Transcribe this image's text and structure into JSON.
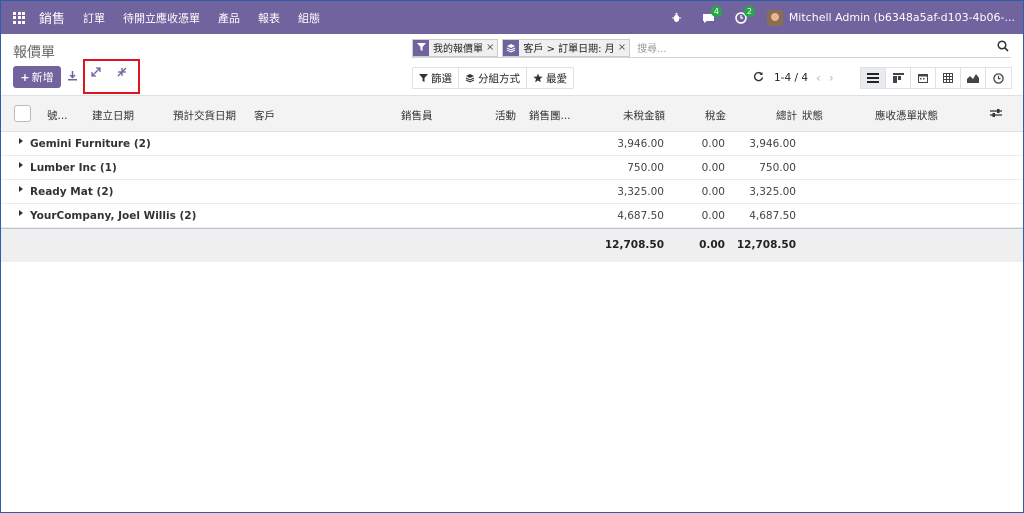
{
  "navbar": {
    "brand": "銷售",
    "menu": [
      "訂單",
      "待開立應收憑單",
      "產品",
      "報表",
      "組態"
    ],
    "messages_count": "4",
    "activities_count": "2",
    "user": "Mitchell Admin (b6348a5af-d103-4b06-..."
  },
  "control": {
    "title": "報價單",
    "new_label": "新增",
    "facets": [
      {
        "icon": "filter-icon",
        "text": "我的報價單"
      },
      {
        "icon": "layers-icon",
        "text": "客戶 > 訂單日期: 月"
      }
    ],
    "search_placeholder": "搜尋...",
    "filter_label": "篩選",
    "groupby_label": "分組方式",
    "favorite_label": "最愛",
    "pager": "1-4 / 4"
  },
  "table": {
    "headers": {
      "number": "號...",
      "create_date": "建立日期",
      "delivery_date": "預計交貨日期",
      "customer": "客戶",
      "salesperson": "銷售員",
      "activity": "活動",
      "sales_team": "銷售團...",
      "untaxed": "未稅金額",
      "tax": "稅金",
      "total": "總計",
      "status": "狀態",
      "invoice_status": "應收憑單狀態"
    },
    "groups": [
      {
        "name": "Gemini Furniture (2)",
        "untaxed": "3,946.00",
        "tax": "0.00",
        "total": "3,946.00"
      },
      {
        "name": "Lumber Inc (1)",
        "untaxed": "750.00",
        "tax": "0.00",
        "total": "750.00"
      },
      {
        "name": "Ready Mat (2)",
        "untaxed": "3,325.00",
        "tax": "0.00",
        "total": "3,325.00"
      },
      {
        "name": "YourCompany, Joel Willis (2)",
        "untaxed": "4,687.50",
        "tax": "0.00",
        "total": "4,687.50"
      }
    ],
    "totals": {
      "untaxed": "12,708.50",
      "tax": "0.00",
      "total": "12,708.50"
    }
  },
  "colors": {
    "brand": "#71639e",
    "badge": "#28a745",
    "highlight": "#e0141e"
  }
}
